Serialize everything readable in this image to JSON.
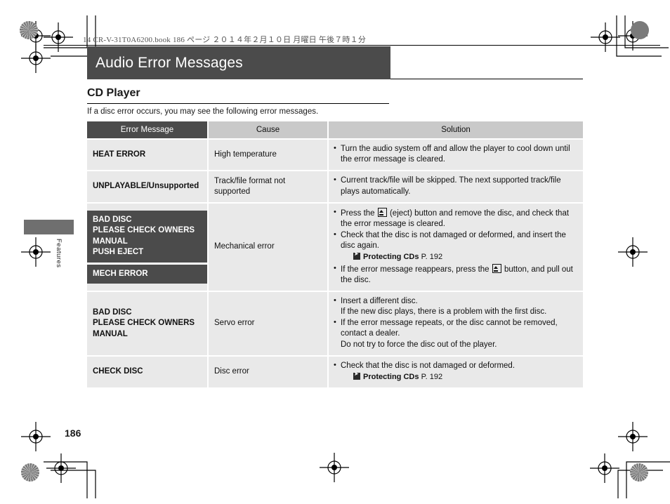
{
  "print_header": {
    "line": "14 CR-V-31T0A6200.book   186 ページ   ２０１４年２月１０日   月曜日   午後７時１分"
  },
  "title_band": {
    "title": "Audio Error Messages"
  },
  "section": {
    "heading": "CD Player",
    "intro": "If a disc error occurs, you may see the following error messages."
  },
  "side_tab": {
    "label": "Features"
  },
  "table": {
    "columns": [
      "Error Message",
      "Cause",
      "Solution"
    ],
    "rows": [
      {
        "error_messages": [
          "HEAT ERROR"
        ],
        "cause": "High temperature",
        "solution": [
          {
            "text": "Turn the audio system off and allow the player to cool down until the error message is cleared."
          }
        ]
      },
      {
        "error_messages": [
          "UNPLAYABLE/Unsupported"
        ],
        "cause": "Track/file format not supported",
        "solution": [
          {
            "text": "Current track/file will be skipped. The next supported track/file plays automatically."
          }
        ]
      },
      {
        "error_messages": [
          "BAD DISC\nPLEASE CHECK OWNERS\nMANUAL\nPUSH EJECT",
          "MECH ERROR"
        ],
        "cause": "Mechanical error",
        "solution": [
          {
            "pre": "Press the ",
            "icon": "eject-icon",
            "post": " (eject) button and remove the disc, and check that the error message is cleared."
          },
          {
            "text": "Check that the disc is not damaged or deformed, and insert the disc again.",
            "xref": {
              "icon": "book-ref-icon",
              "name": "Protecting CDs",
              "page": "P. 192"
            }
          },
          {
            "pre": "If the error message reappears, press the ",
            "icon": "eject-icon",
            "post": " button, and pull out the disc."
          }
        ]
      },
      {
        "error_messages": [
          "BAD DISC\nPLEASE CHECK OWNERS\nMANUAL"
        ],
        "cause": "Servo error",
        "solution": [
          {
            "text": "Insert a different disc.",
            "sub": "If the new disc plays, there is a problem with the first disc."
          },
          {
            "text": "If the error message repeats, or the disc cannot be removed, contact a dealer.",
            "sub": "Do not try to force the disc out of the player."
          }
        ]
      },
      {
        "error_messages": [
          "CHECK DISC"
        ],
        "cause": "Disc error",
        "solution": [
          {
            "text": "Check that the disc is not damaged or deformed.",
            "xref": {
              "icon": "book-ref-icon",
              "name": "Protecting CDs",
              "page": "P. 192"
            }
          }
        ]
      }
    ]
  },
  "folio": {
    "page_number": "186"
  },
  "colors": {
    "band_dark": "#4b4b4b",
    "header_gray": "#c9c9c9",
    "cell_gray": "#e9e9e9",
    "page_white": "#ffffff"
  }
}
